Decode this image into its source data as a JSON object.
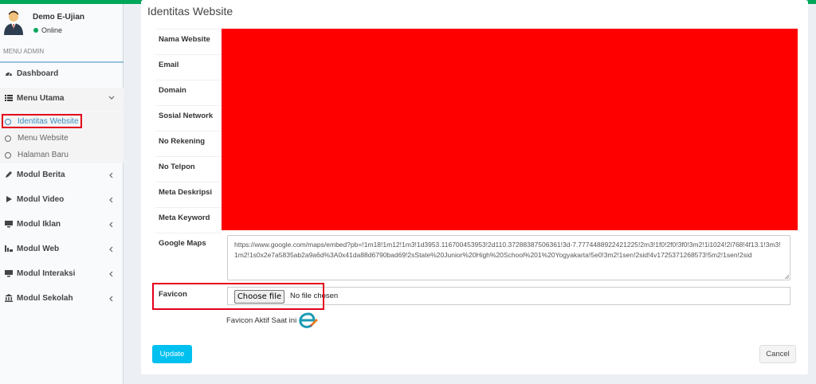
{
  "colors": {
    "accent": "#00a65a",
    "primary": "#3c8dbc",
    "highlight": "#e3001b",
    "redaction": "#ff0000",
    "update": "#00c0ef"
  },
  "user": {
    "name": "Demo E-Ujian",
    "status": "Online"
  },
  "menu_header": "MENU ADMIN",
  "nav": {
    "dashboard": {
      "label": "Dashboard",
      "icon": "dashboard-icon"
    },
    "menu_utama": {
      "label": "Menu Utama",
      "icon": "list-icon"
    },
    "modul_berita": {
      "label": "Modul Berita",
      "icon": "pencil-icon"
    },
    "modul_video": {
      "label": "Modul Video",
      "icon": "play-icon"
    },
    "modul_iklan": {
      "label": "Modul Iklan",
      "icon": "monitor-icon"
    },
    "modul_web": {
      "label": "Modul Web",
      "icon": "web-icon"
    },
    "modul_interaksi": {
      "label": "Modul Interaksi",
      "icon": "monitor-icon"
    },
    "modul_sekolah": {
      "label": "Modul Sekolah",
      "icon": "institution-icon"
    }
  },
  "submenu": {
    "identitas": "Identitas Website",
    "menu_website": "Menu Website",
    "halaman_baru": "Halaman Baru"
  },
  "form": {
    "title": "Identitas Website",
    "labels": {
      "nama_website": "Nama Website",
      "email": "Email",
      "domain": "Domain",
      "sosial_network": "Sosial Network",
      "no_rekening": "No Rekening",
      "no_telpon": "No Telpon",
      "meta_deskripsi": "Meta Deskripsi",
      "meta_keyword": "Meta Keyword",
      "google_maps": "Google Maps",
      "favicon": "Favicon"
    },
    "google_maps_value": "https://www.google.com/maps/embed?pb=!1m18!1m12!1m3!1d3953.116700453953!2d110.37288387506361!3d-7.7774488922421225!2m3!1f0!2f0!3f0!3m2!1i1024!2i768!4f13.1!3m3!1m2!1s0x2e7a5835ab2a9a6d%3A0x41da88d6790bad69!2sState%20Junior%20High%20School%201%20Yogyakarta!5e0!3m2!1sen!2sid!4v1725371268573!5m2!1sen!2sid",
    "file_button": "Choose file",
    "file_status": "No file chosen",
    "favicon_active_label": "Favicon Aktif Saat ini :"
  },
  "buttons": {
    "update": "Update",
    "cancel": "Cancel"
  }
}
